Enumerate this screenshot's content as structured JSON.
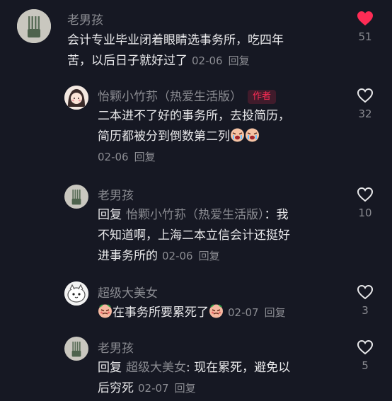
{
  "comments": [
    {
      "username": "老男孩",
      "lines": [
        "会计专业毕业闭着眼睛选事务所，吃四年",
        "苦，以后日子就好过了"
      ],
      "date": "02-06",
      "reply_label": "回复",
      "likes": "51",
      "liked": true
    },
    {
      "username": "怡颗小竹荪（热爱生活版）",
      "badge": "作者",
      "lines": [
        "二本进不了好的事务所，去投简历，",
        "简历都被分到倒数第二列"
      ],
      "date": "02-06",
      "reply_label": "回复",
      "likes": "32"
    },
    {
      "username": "老男孩",
      "reply_prefix": "回复",
      "reply_to": "怡颗小竹荪（热爱生活版）",
      "lines": [
        "：我",
        "不知道啊，上海二本立信会计还挺好",
        "进事务所的"
      ],
      "date": "02-06",
      "reply_label": "回复",
      "likes": "10"
    },
    {
      "username": "超级大美女",
      "lines": [
        "在事务所要累死了"
      ],
      "date": "02-07",
      "reply_label": "回复",
      "likes": "3"
    },
    {
      "username": "老男孩",
      "reply_prefix": "回复",
      "reply_to": "超级大美女",
      "lines": [
        ": 现在累死，避免以",
        "后穷死"
      ],
      "date": "02-07",
      "reply_label": "回复",
      "likes": "5"
    }
  ],
  "colors": {
    "background": "#161823",
    "like_active": "#fe2c55",
    "muted": "#8b8c92",
    "text": "#e9e9eb"
  },
  "icons": [
    "heart-filled-icon",
    "heart-outline-icon",
    "crying-face-emoji",
    "angry-face-emoji",
    "comb-avatar"
  ]
}
